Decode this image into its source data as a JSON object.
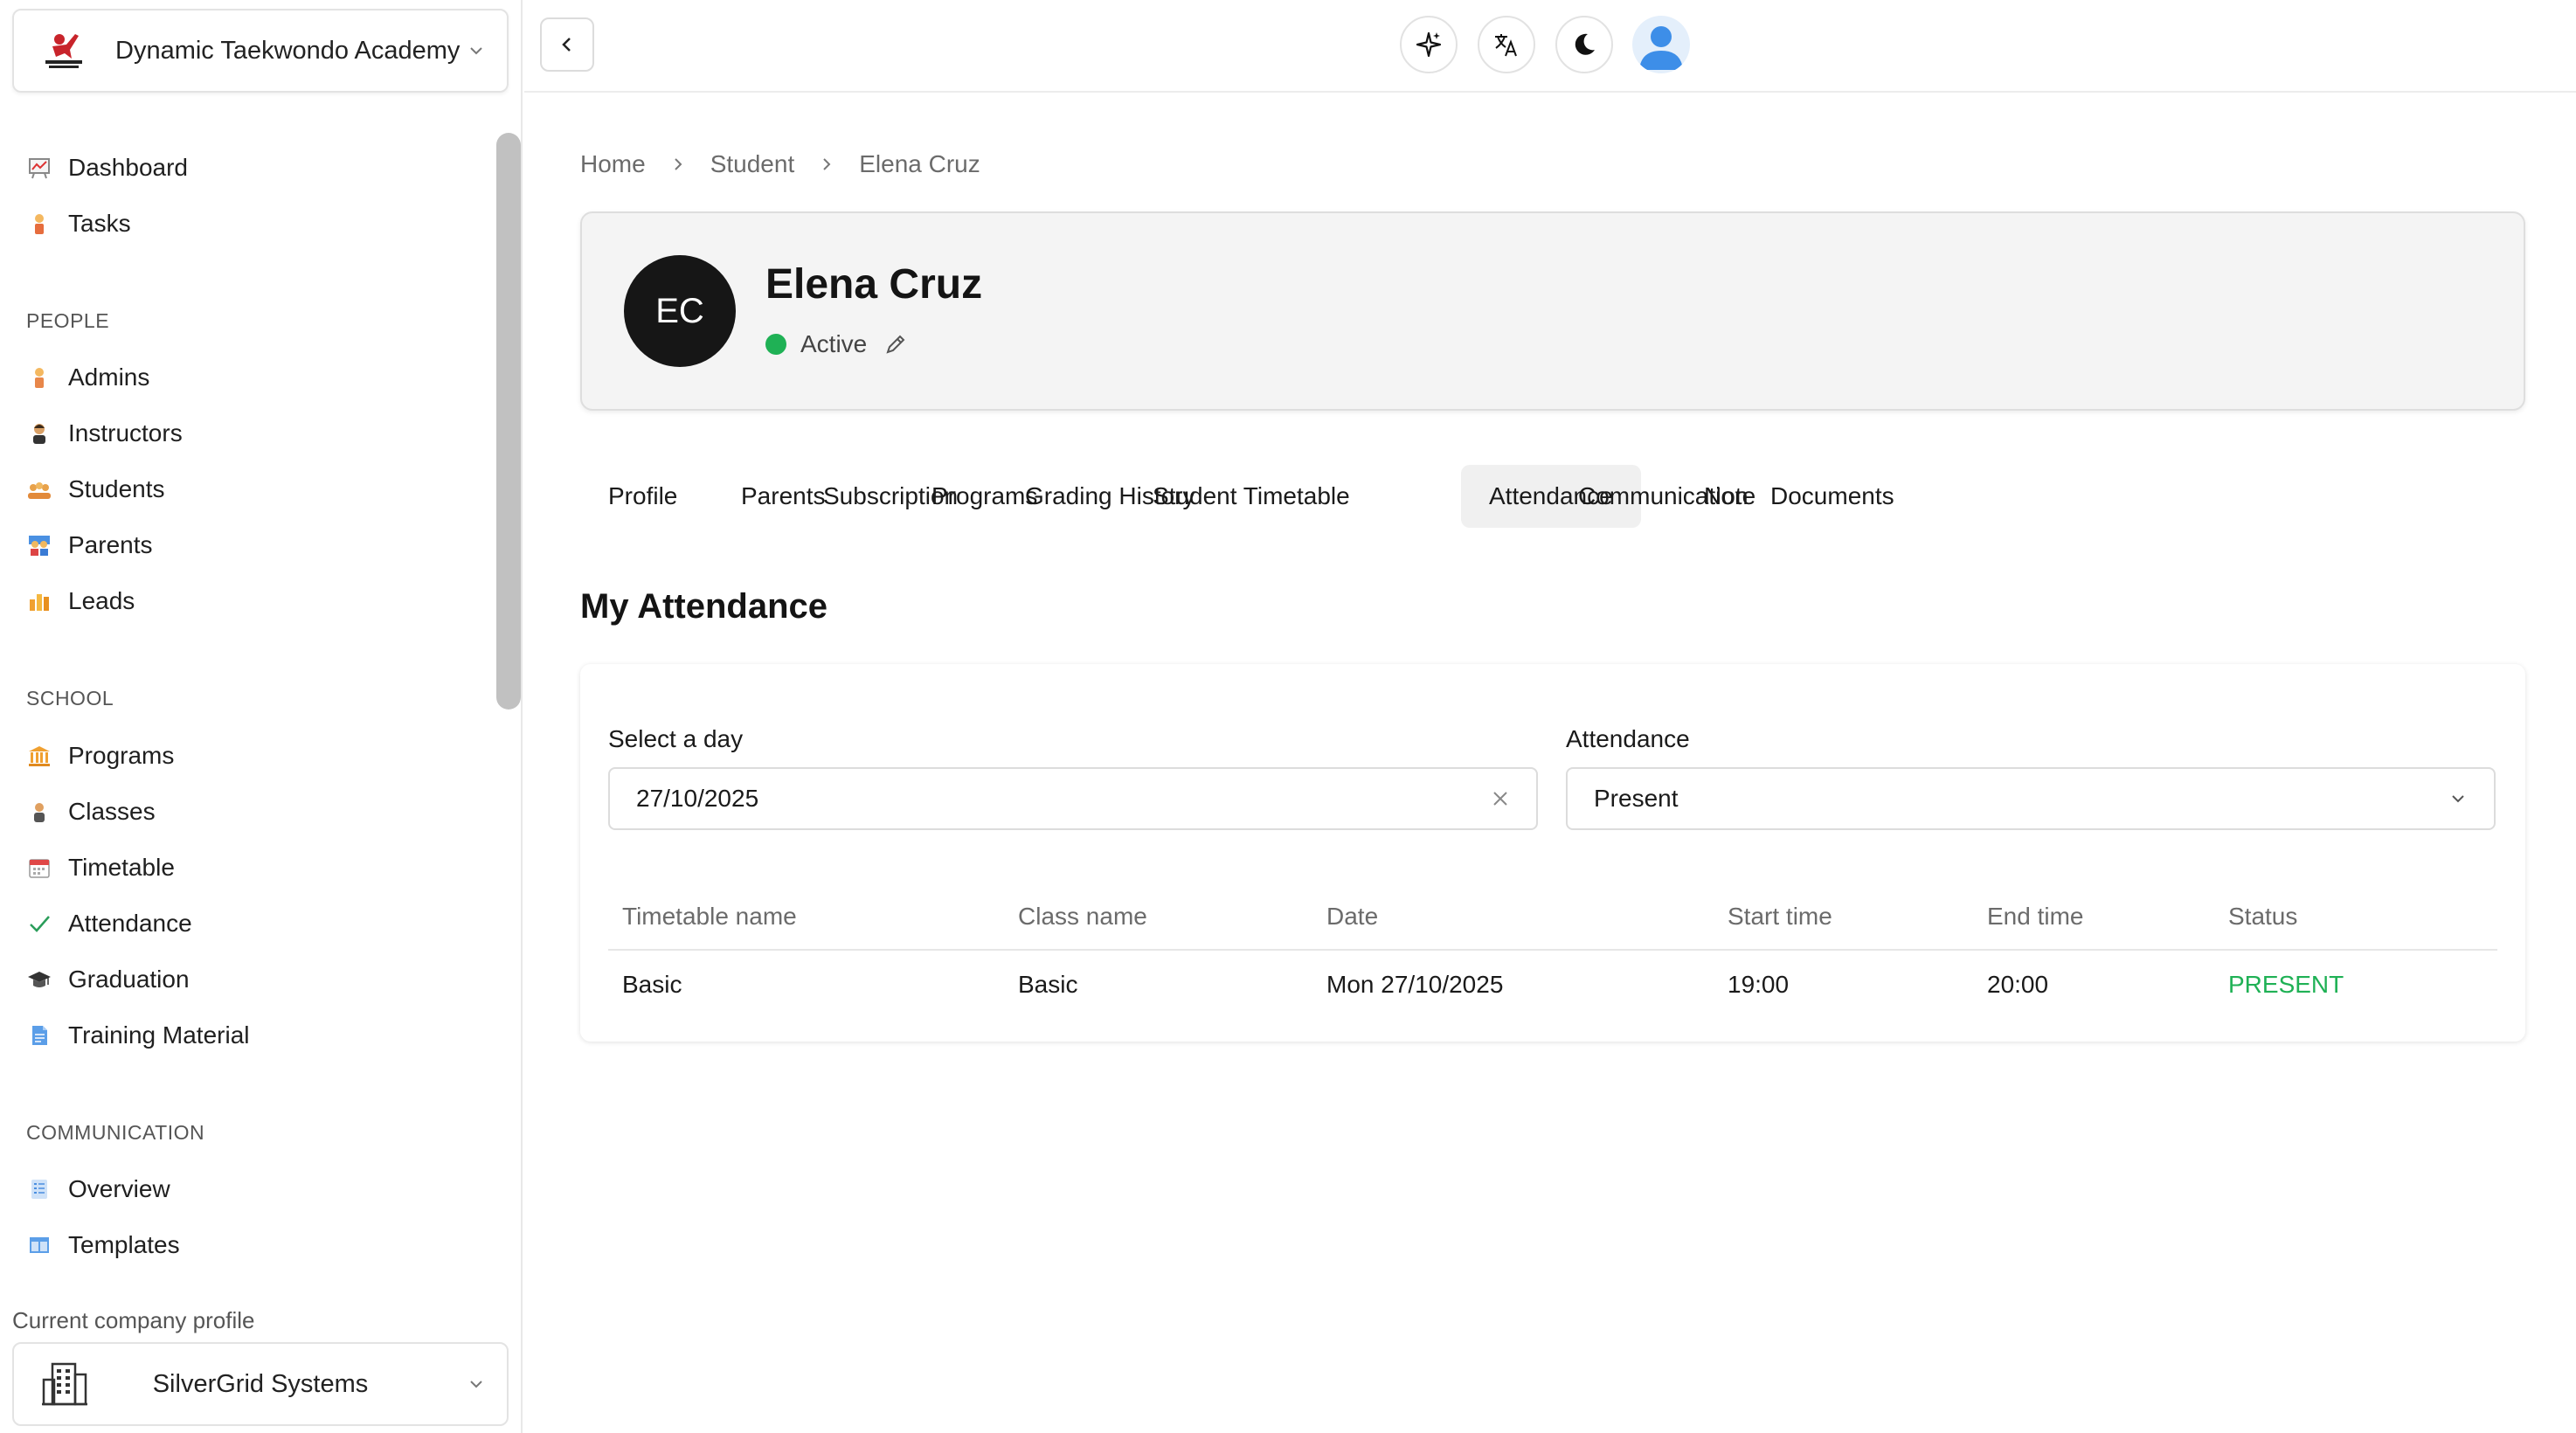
{
  "org": {
    "name": "Dynamic Taekwondo Academy",
    "logo_icon": "taekwondo-logo-icon"
  },
  "sidebar": {
    "items_top": [
      {
        "label": "Dashboard",
        "icon": "chart-board-icon"
      },
      {
        "label": "Tasks",
        "icon": "person-task-icon"
      }
    ],
    "people": {
      "title": "PEOPLE",
      "items": [
        {
          "label": "Admins",
          "icon": "admin-person-icon"
        },
        {
          "label": "Instructors",
          "icon": "instructor-person-icon"
        },
        {
          "label": "Students",
          "icon": "students-group-icon"
        },
        {
          "label": "Parents",
          "icon": "parents-icon"
        },
        {
          "label": "Leads",
          "icon": "bar-chart-icon"
        }
      ]
    },
    "school": {
      "title": "SCHOOL",
      "items": [
        {
          "label": "Programs",
          "icon": "building-columns-icon"
        },
        {
          "label": "Classes",
          "icon": "class-person-icon"
        },
        {
          "label": "Timetable",
          "icon": "calendar-icon"
        },
        {
          "label": "Attendance",
          "icon": "checkmark-icon"
        },
        {
          "label": "Graduation",
          "icon": "graduation-cap-icon"
        },
        {
          "label": "Training Material",
          "icon": "document-icon"
        }
      ]
    },
    "communication": {
      "title": "COMMUNICATION",
      "items": [
        {
          "label": "Overview",
          "icon": "list-doc-icon"
        },
        {
          "label": "Templates",
          "icon": "template-icon"
        }
      ]
    },
    "company_label": "Current company profile",
    "company_name": "SilverGrid Systems"
  },
  "topbar": {
    "icons": [
      "sparkle-icon",
      "translate-icon",
      "moon-icon",
      "user-avatar-icon"
    ]
  },
  "breadcrumb": [
    "Home",
    "Student",
    "Elena Cruz"
  ],
  "profile": {
    "initials": "EC",
    "name": "Elena Cruz",
    "status": "Active",
    "status_color": "#1fb155"
  },
  "tabs": [
    "Profile",
    "Parents",
    "Subscription",
    "Programs",
    "Grading History",
    "Student Timetable",
    "Attendance",
    "Communication",
    "Note",
    "Documents"
  ],
  "active_tab": "Attendance",
  "attendance": {
    "title": "My Attendance",
    "day_label": "Select a day",
    "day_value": "27/10/2025",
    "attendance_label": "Attendance",
    "attendance_value": "Present",
    "columns": [
      "Timetable name",
      "Class name",
      "Date",
      "Start time",
      "End time",
      "Status"
    ],
    "rows": [
      [
        "Basic",
        "Basic",
        "Mon 27/10/2025",
        "19:00",
        "20:00",
        "PRESENT"
      ]
    ],
    "present_color": "#1fb155"
  }
}
